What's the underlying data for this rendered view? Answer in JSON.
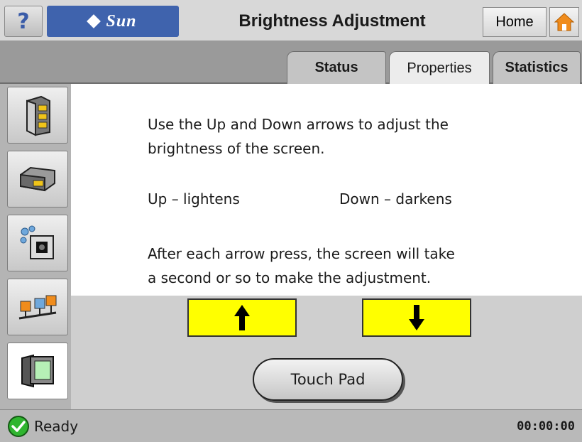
{
  "header": {
    "help_label": "?",
    "logo_text": "Sun",
    "title": "Brightness Adjustment",
    "home_label": "Home"
  },
  "tabs": [
    {
      "label": "Status",
      "active": false
    },
    {
      "label": "Properties",
      "active": true
    },
    {
      "label": "Statistics",
      "active": false
    }
  ],
  "sidebar": {
    "items": [
      {
        "icon": "storage-tower-icon"
      },
      {
        "icon": "disk-drive-icon"
      },
      {
        "icon": "settings-camera-icon"
      },
      {
        "icon": "network-icon"
      },
      {
        "icon": "monitor-icon",
        "active": true
      }
    ]
  },
  "content": {
    "intro_line1": "Use the Up and Down arrows to adjust the",
    "intro_line2": "brightness of the screen.",
    "up_label": "Up – lightens",
    "down_label": "Down – darkens",
    "after_line1": "After each arrow press,  the screen will take",
    "after_line2": "a second or so to make the adjustment."
  },
  "controls": {
    "up_icon": "arrow-up-icon",
    "down_icon": "arrow-down-icon",
    "touchpad_label": "Touch Pad"
  },
  "status": {
    "text": "Ready",
    "time": "00:00:00"
  },
  "colors": {
    "logo_bg": "#3f63ad",
    "arrow_button": "#ffff00",
    "ready_green": "#2fb52f",
    "home_orange": "#f08c1c"
  }
}
